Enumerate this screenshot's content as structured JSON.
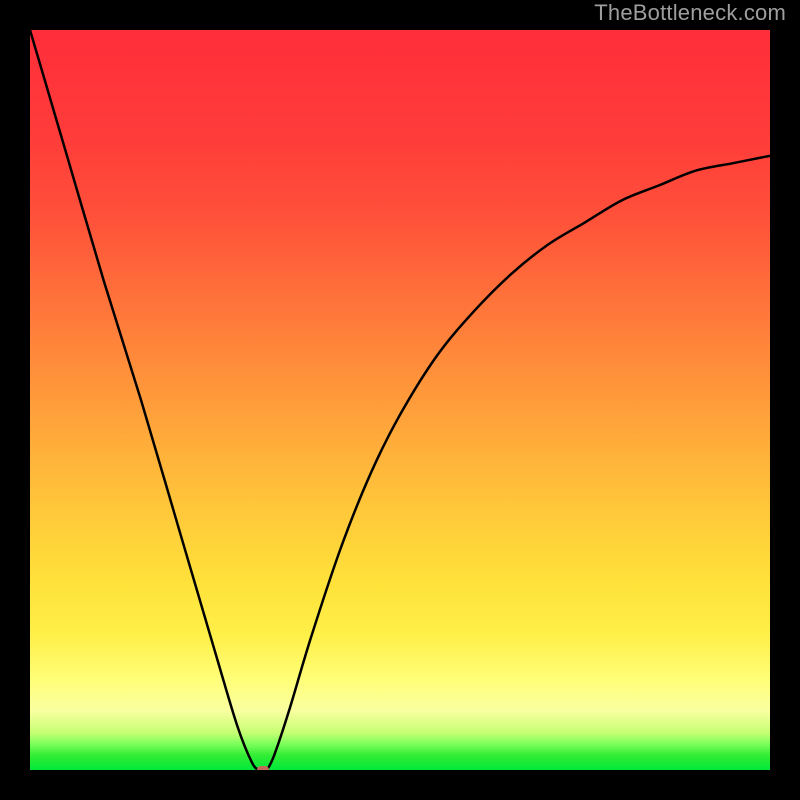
{
  "watermark": "TheBottleneck.com",
  "chart_data": {
    "type": "line",
    "title": "",
    "xlabel": "",
    "ylabel": "",
    "xlim": [
      0,
      1
    ],
    "ylim": [
      0,
      1
    ],
    "x": [
      0.0,
      0.05,
      0.1,
      0.15,
      0.2,
      0.25,
      0.28,
      0.3,
      0.31,
      0.315,
      0.32,
      0.33,
      0.35,
      0.38,
      0.42,
      0.46,
      0.5,
      0.55,
      0.6,
      0.65,
      0.7,
      0.75,
      0.8,
      0.85,
      0.9,
      0.95,
      1.0
    ],
    "values": [
      1.0,
      0.83,
      0.66,
      0.5,
      0.33,
      0.16,
      0.06,
      0.01,
      0.0,
      0.0,
      0.0,
      0.02,
      0.08,
      0.18,
      0.3,
      0.4,
      0.48,
      0.56,
      0.62,
      0.67,
      0.71,
      0.74,
      0.77,
      0.79,
      0.81,
      0.82,
      0.83
    ],
    "min_point": {
      "x": 0.315,
      "y": 0.0
    },
    "gradient_stops": [
      {
        "pos": 0.0,
        "color": "#00e83a"
      },
      {
        "pos": 0.12,
        "color": "#ffff7a"
      },
      {
        "pos": 0.45,
        "color": "#ffaa3a"
      },
      {
        "pos": 1.0,
        "color": "#ff2d3a"
      }
    ]
  }
}
